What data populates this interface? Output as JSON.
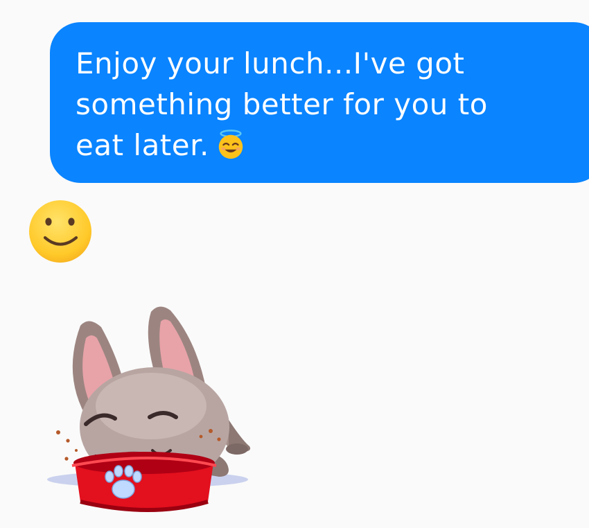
{
  "message": {
    "text": "Enjoy your lunch...I've got\nsomething better for you to\neat later.",
    "trailing_emoji": "smiling-face-with-halo-icon",
    "bubble_color": "#0a84ff",
    "text_color": "#ffffff"
  },
  "reaction": {
    "emoji": "slightly-smiling-face-icon"
  },
  "sticker": {
    "icon": "puppy-eating-from-bowl-sticker"
  },
  "background_color": "#fafafa"
}
